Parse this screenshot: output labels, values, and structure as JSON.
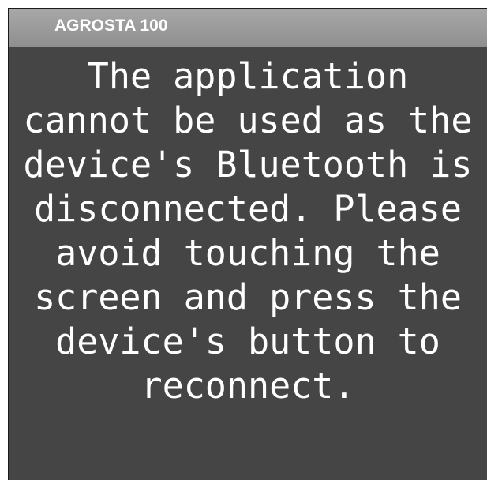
{
  "window": {
    "title": "AGROSTA 100"
  },
  "dialog": {
    "message": "The application\ncannot be used as the\ndevice's Bluetooth is\ndisconnected. Please\navoid touching the\nscreen and press the\ndevice's button to\nreconnect."
  },
  "colors": {
    "background": "#454545",
    "title_bar": "#9a9a9a",
    "text": "#ffffff"
  }
}
